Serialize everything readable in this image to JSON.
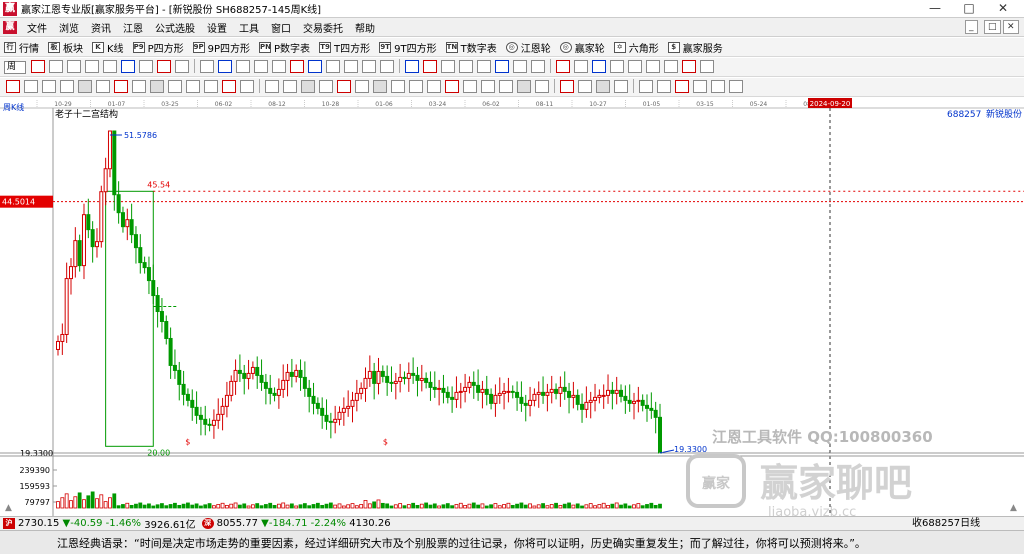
{
  "window": {
    "title": "赢家江恩专业版[赢家服务平台] - [新锐股份  SH688257-145周K线]",
    "minimize": "—",
    "maximize": "□",
    "close": "✕",
    "logo": "赢"
  },
  "menu": {
    "items": [
      "文件",
      "浏览",
      "资讯",
      "江恩",
      "公式选股",
      "设置",
      "工具",
      "窗口",
      "交易委托",
      "帮助"
    ],
    "doc_controls": [
      "_",
      "□",
      "✕"
    ]
  },
  "toolbar1": {
    "items": [
      {
        "icon": "行",
        "label": "行情"
      },
      {
        "icon": "板",
        "label": "板块"
      },
      {
        "icon": "K",
        "label": "K线"
      },
      {
        "icon": "P9",
        "label": "P四方形"
      },
      {
        "icon": "9P",
        "label": "9P四方形"
      },
      {
        "icon": "PN",
        "label": "P数字表"
      },
      {
        "icon": "T9",
        "label": "T四方形"
      },
      {
        "icon": "9T",
        "label": "9T四方形"
      },
      {
        "icon": "TN",
        "label": "T数字表"
      },
      {
        "icon": "◎",
        "label": "江恩轮"
      },
      {
        "icon": "◎",
        "label": "赢家轮"
      },
      {
        "icon": "✡",
        "label": "六角形"
      },
      {
        "icon": "$",
        "label": "赢家服务"
      }
    ]
  },
  "toolbar2": {
    "period": "周"
  },
  "chart_data": {
    "type": "candlestick",
    "period_label": "周K线",
    "stock_code": "688257",
    "stock_name": "新锐股份",
    "indicator_title": "老子十二宫结构",
    "date_ticks": [
      "10-29",
      "01-07",
      "03-25",
      "06-02",
      "08-12",
      "10-28",
      "01-06",
      "03-24",
      "06-02",
      "08-11",
      "10-27",
      "01-05",
      "03-15",
      "05-24",
      "08-02"
    ],
    "cursor_date": "2024-09-20",
    "cursor_price": "44.5014",
    "price_high_label": "51.5786",
    "price_low_label": "19.3300",
    "ylim": [
      19.33,
      51.58
    ],
    "annotations": {
      "box_top": "45.54",
      "box_bottom": "20.00",
      "dollar_marks": [
        "$",
        "$"
      ]
    },
    "candles_close": [
      30.5,
      31.2,
      36.8,
      38.0,
      40.6,
      38.1,
      43.2,
      41.7,
      40.0,
      40.5,
      45.5,
      47.8,
      51.58,
      45.2,
      43.4,
      42.0,
      42.7,
      41.2,
      39.9,
      38.4,
      37.9,
      36.6,
      35.1,
      33.5,
      32.5,
      30.8,
      28.1,
      27.6,
      26.2,
      25.2,
      24.6,
      23.9,
      23.1,
      22.7,
      22.2,
      22.1,
      22.6,
      23.2,
      24.0,
      25.1,
      26.5,
      27.6,
      27.3,
      26.8,
      27.3,
      27.9,
      27.1,
      26.4,
      25.8,
      25.3,
      25.1,
      25.7,
      26.6,
      27.4,
      27.0,
      27.6,
      26.9,
      25.8,
      25.0,
      24.3,
      23.8,
      23.1,
      22.5,
      22.4,
      22.7,
      23.4,
      23.8,
      24.0,
      24.6,
      25.3,
      25.8,
      26.8,
      27.5,
      26.3,
      27.5,
      27.0,
      26.4,
      26.3,
      26.5,
      26.9,
      26.8,
      27.3,
      27.1,
      26.6,
      26.8,
      26.4,
      25.9,
      25.7,
      25.8,
      25.4,
      24.9,
      24.7,
      25.4,
      25.5,
      25.9,
      26.4,
      26.1,
      25.4,
      25.7,
      25.2,
      24.3,
      25.1,
      25.3,
      25.5,
      25.5,
      25.4,
      24.9,
      24.3,
      24.1,
      24.6,
      25.2,
      25.4,
      25.1,
      25.4,
      25.7,
      25.3,
      25.9,
      25.5,
      24.9,
      25.1,
      24.2,
      23.7,
      24.4,
      24.6,
      24.9,
      25.1,
      25.1,
      25.6,
      25.3,
      25.6,
      25.0,
      24.6,
      24.3,
      24.5,
      24.6,
      24.1,
      23.8,
      23.6,
      22.9,
      19.33
    ],
    "volume_ticks": [
      "239390",
      "159593",
      "79797"
    ],
    "close_volume_label": "收688257日线"
  },
  "statusbar": {
    "sh_index": "2730.15",
    "sh_change": "▼-40.59",
    "sh_pct": "-1.46%",
    "sh_amount": "3926.61亿",
    "sz_index": "8055.77",
    "sz_change": "▼-184.71",
    "sz_pct": "-2.24%",
    "sz_amount": "4130.26",
    "sh_icon": "沪",
    "sz_icon": "深"
  },
  "quote": {
    "text": "江恩经典语录：“时间是决定市场走势的重要因素，经过详细研究大市及个别股票的过往记录，你将可以证明，历史确实重复发生；而了解过往，你将可以预测将来。”。"
  },
  "watermark": {
    "line1": "江恩工具软件  QQ:100800360",
    "line2": "赢家聊吧",
    "seal": "赢家",
    "url": "liaoba.yjzb.cc"
  },
  "colors": {
    "up": "#d40000",
    "down": "#009900",
    "grid": "#c0c0c0",
    "price_tag": "#e30000",
    "highlight_box": "#009900"
  }
}
